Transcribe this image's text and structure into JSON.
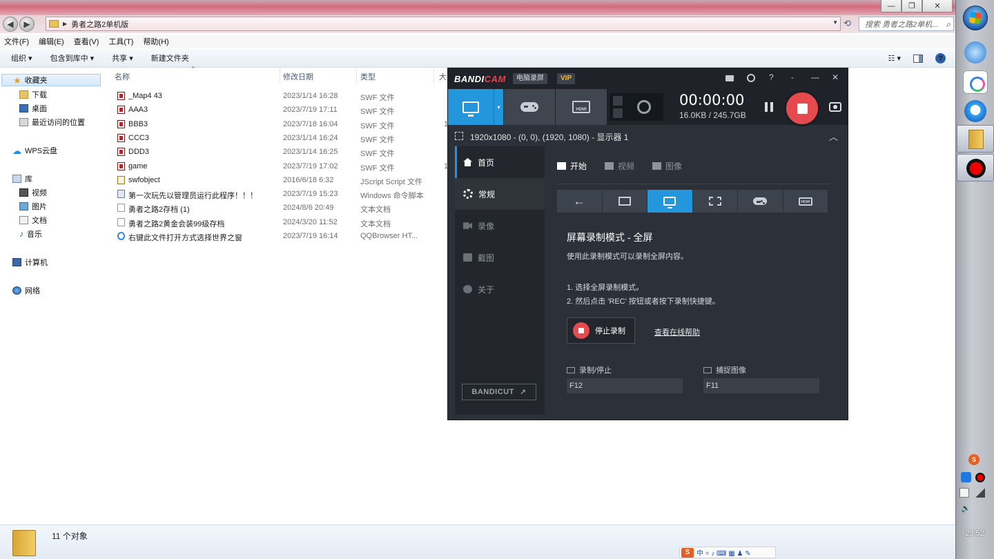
{
  "explorer": {
    "window_buttons": [
      "—",
      "❐",
      "✕"
    ],
    "breadcrumb": "勇者之路2单机版",
    "search_placeholder": "搜索 勇者之路2单机...",
    "menu": [
      "文件(F)",
      "编辑(E)",
      "查看(V)",
      "工具(T)",
      "帮助(H)"
    ],
    "toolbar": [
      "组织 ▾",
      "包含到库中 ▾",
      "共享 ▾",
      "新建文件夹"
    ],
    "nav": {
      "favorites": "收藏夹",
      "downloads": "下载",
      "desktop": "桌面",
      "recent": "最近访问的位置",
      "wps": "WPS云盘",
      "library": "库",
      "videos": "视频",
      "pictures": "图片",
      "documents": "文档",
      "music": "音乐",
      "computer": "计算机",
      "network": "网络"
    },
    "columns": {
      "name": "名称",
      "date": "修改日期",
      "type": "类型",
      "size": "大"
    },
    "files": [
      {
        "name": "_Map4 43",
        "date": "2023/1/14 16:28",
        "type": "SWF 文件",
        "icon": "swf",
        "size": ""
      },
      {
        "name": "AAA3",
        "date": "2023/7/19 17:11",
        "type": "SWF 文件",
        "icon": "swf",
        "size": ""
      },
      {
        "name": "BBB3",
        "date": "2023/7/18 16:04",
        "type": "SWF 文件",
        "icon": "swf",
        "size": "1"
      },
      {
        "name": "CCC3",
        "date": "2023/1/14 16:24",
        "type": "SWF 文件",
        "icon": "swf",
        "size": ""
      },
      {
        "name": "DDD3",
        "date": "2023/1/14 16:25",
        "type": "SWF 文件",
        "icon": "swf",
        "size": ""
      },
      {
        "name": "game",
        "date": "2023/7/19 17:02",
        "type": "SWF 文件",
        "icon": "swf",
        "size": "1"
      },
      {
        "name": "swfobject",
        "date": "2016/6/18 6:32",
        "type": "JScript Script 文件",
        "icon": "js",
        "size": ""
      },
      {
        "name": "第一次玩先以管理员运行此程序！！！",
        "date": "2023/7/19 15:23",
        "type": "Windows 命令脚本",
        "icon": "cmd",
        "size": ""
      },
      {
        "name": "勇者之路2存档 (1)",
        "date": "2024/8/6 20:49",
        "type": "文本文档",
        "icon": "txt",
        "size": ""
      },
      {
        "name": "勇者之路2黄金会装99级存档",
        "date": "2024/3/20 11:52",
        "type": "文本文档",
        "icon": "txt",
        "size": ""
      },
      {
        "name": "右键此文件打开方式选择世界之窗",
        "date": "2023/7/19 16:14",
        "type": "QQBrowser HT...",
        "icon": "qq",
        "size": ""
      }
    ],
    "status": "11 个对象"
  },
  "ime": {
    "logo": "S",
    "text": "中 ⸰ ♪ ⌨ ▦ ♟ ✎"
  },
  "taskbar": {
    "clock": "23:52",
    "tray_sogou": "S",
    "tray_volume": "🔈"
  },
  "bandicam": {
    "logo_a": "BANDI",
    "logo_b": "CAM",
    "mode_label": "电脑录屏",
    "vip": "VIP",
    "title_icons": {
      "help": "?",
      "min_tray": "-",
      "minimize": "—",
      "close": "✕"
    },
    "dropdown_arrow": "▾",
    "hdmi_text": "HDMI",
    "timer": "00:00:00",
    "size_info": "16.0KB / 245.7GB",
    "region": "1920x1080 - (0, 0), (1920, 1080) - 显示器 1",
    "collapse": "︿",
    "sidebar": [
      "首页",
      "常规",
      "录像",
      "截图",
      "关于"
    ],
    "bandicut": "BANDICUT",
    "bandicut_arrow": "↗",
    "tabs": [
      "开始",
      "视频",
      "图像"
    ],
    "back_arrow": "←",
    "mode_title": "屏幕录制模式 - 全屏",
    "mode_desc": "使用此录制模式可以录制全屏内容。",
    "step1": "1. 选择全屏录制模式。",
    "step2": "2. 然后点击 'REC' 按钮或者按下录制快捷键。",
    "stop_button": "停止录制",
    "help_link": "查看在线帮助",
    "hotkeys": [
      {
        "label": "录制/停止",
        "key": "F12"
      },
      {
        "label": "捕捉图像",
        "key": "F11"
      }
    ],
    "accent": "#2497dc",
    "record_red": "#e54a4f"
  }
}
